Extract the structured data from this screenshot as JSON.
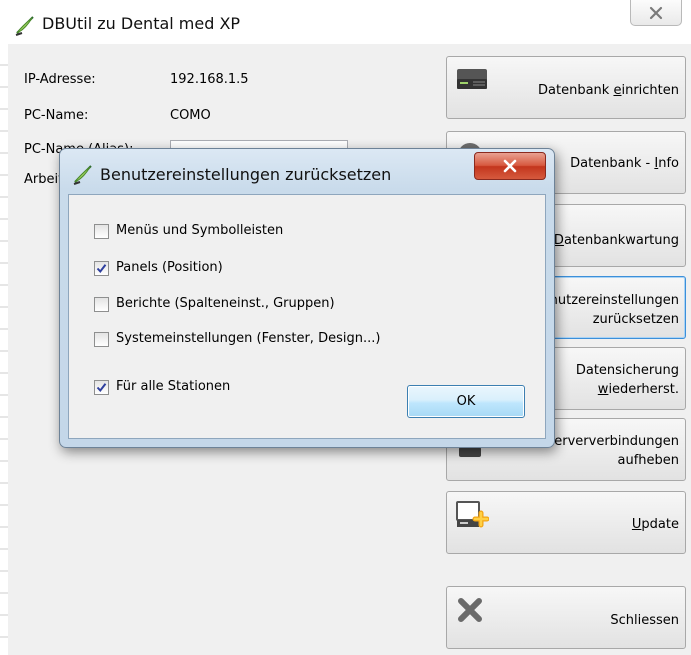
{
  "window": {
    "title": "DBUtil zu Dental med XP"
  },
  "info": {
    "ip_label": "IP-Adresse:",
    "ip_value": "192.168.1.5",
    "pc_name_label": "PC-Name:",
    "pc_name_value": "COMO",
    "alias_label": "PC-Name (Alias):",
    "station_label": "Arbeitsstation:"
  },
  "actions": [
    {
      "pre": "Datenbank ",
      "u": "e",
      "post": "inrichten",
      "icon": "server-icon"
    },
    {
      "pre": "Datenbank - ",
      "u": "I",
      "post": "nfo",
      "icon": "help-icon"
    },
    {
      "pre": "",
      "u": "D",
      "post": "atenbankwartung",
      "icon": "maintenance-icon"
    },
    {
      "pre": "Benutzereinstellungen\nzurücksetzen",
      "u": "",
      "post": "",
      "icon": "reset-icon"
    },
    {
      "pre": "Datensicherung\n",
      "u": "w",
      "post": "iederherst.",
      "icon": "restore-icon"
    },
    {
      "pre": "Serververbindungen\naufheben",
      "u": "",
      "post": "",
      "icon": "disconnect-icon"
    },
    {
      "pre": "",
      "u": "U",
      "post": "pdate",
      "icon": "update-icon"
    },
    {
      "pre": "Schliessen",
      "u": "",
      "post": "",
      "icon": "close-x-icon"
    }
  ],
  "dialog": {
    "title": "Benutzereinstellungen zurücksetzen",
    "options": [
      {
        "label": "Menüs und Symbolleisten",
        "checked": false
      },
      {
        "label": "Panels (Position)",
        "checked": true
      },
      {
        "label": "Berichte (Spalteneinst., Gruppen)",
        "checked": false
      },
      {
        "label": "Systemeinstellungen (Fenster, Design...)",
        "checked": false
      },
      {
        "label": "Für alle Stationen",
        "checked": true
      }
    ],
    "ok_label": "OK"
  },
  "colors": {
    "accent": "#3c8fd9",
    "close_red": "#c3351d",
    "dialog_frame": "#c4d7e9"
  }
}
